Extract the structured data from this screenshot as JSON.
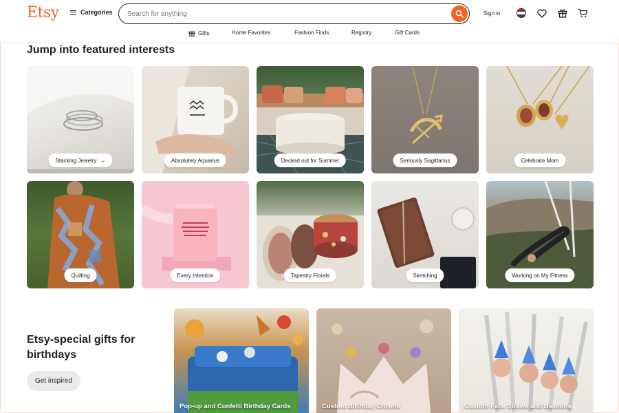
{
  "header": {
    "logo": "Etsy",
    "categories_label": "Categories",
    "search_placeholder": "Search for anything",
    "signin_label": "Sign in"
  },
  "subnav": [
    {
      "label": "Gifts",
      "icon": "gift-icon"
    },
    {
      "label": "Home Favorites"
    },
    {
      "label": "Fashion Finds"
    },
    {
      "label": "Registry"
    },
    {
      "label": "Gift Cards"
    }
  ],
  "featured": {
    "title": "Jump into featured interests",
    "tiles": [
      {
        "label": "Stacking Jewelry",
        "arrow": "→"
      },
      {
        "label": "Absolutely Aquarius"
      },
      {
        "label": "Decked out for Summer"
      },
      {
        "label": "Seriously Sagittarius"
      },
      {
        "label": "Celebrate Mom"
      },
      {
        "label": "Quilting"
      },
      {
        "label": "Every Intention"
      },
      {
        "label": "Tapestry Florals"
      },
      {
        "label": "Sketching"
      },
      {
        "label": "Working on My Fitness"
      }
    ]
  },
  "birthday": {
    "title": "Etsy-special gifts for birthdays",
    "button": "Get inspired",
    "cards": [
      {
        "label": "Pop-up and Confetti Birthday Cards"
      },
      {
        "label": "Custom Birthday Crowns"
      },
      {
        "label": "Custom Face Straws and Balloons"
      }
    ]
  },
  "colors": {
    "brand": "#f1641e",
    "text": "#222222"
  }
}
